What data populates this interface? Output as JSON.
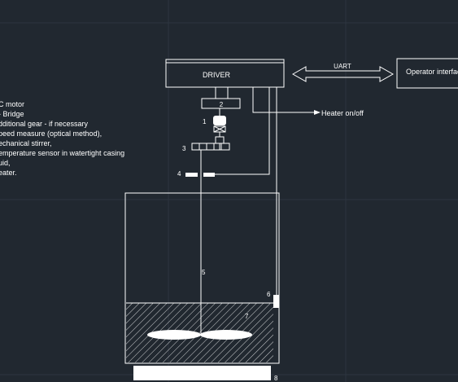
{
  "blocks": {
    "driver": "DRIVER",
    "operator": "Operator interface",
    "uart": "UART",
    "heater_output": "Heater on/off"
  },
  "labels": {
    "n1": "1",
    "n2": "2",
    "n3": "3",
    "n4": "4",
    "n5": "5",
    "n6": "6",
    "n7": "7",
    "n8": "8"
  },
  "legend": [
    "C motor",
    "- Bridge",
    "dditional gear - if necessary",
    "peed measure (optical method),",
    "echanical stirrer,",
    "emperature sensor in watertight casing",
    "uid,",
    "eater."
  ]
}
